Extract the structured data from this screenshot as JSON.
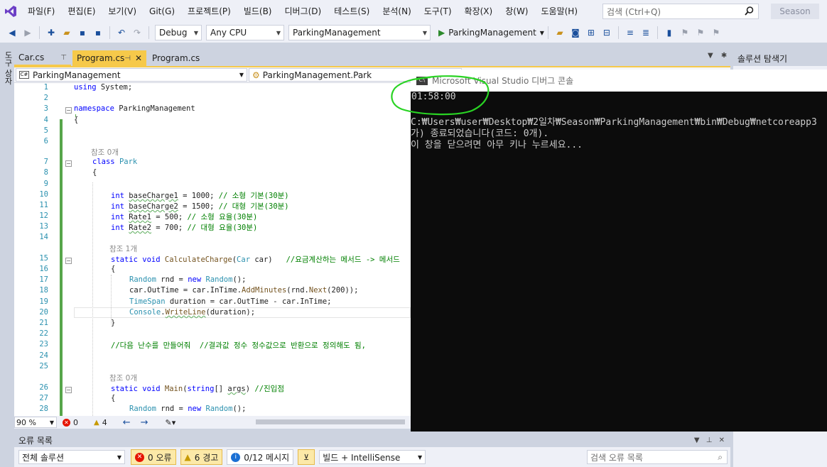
{
  "menu": {
    "items": [
      "파일(F)",
      "편집(E)",
      "보기(V)",
      "Git(G)",
      "프로젝트(P)",
      "빌드(B)",
      "디버그(D)",
      "테스트(S)",
      "분석(N)",
      "도구(T)",
      "확장(X)",
      "창(W)",
      "도움말(H)"
    ],
    "search_placeholder": "검색 (Ctrl+Q)",
    "account": "Season"
  },
  "toolbar": {
    "config": "Debug",
    "platform": "Any CPU",
    "project": "ParkingManagement",
    "run_label": "ParkingManagement"
  },
  "left_strip": {
    "label": "도구 상자"
  },
  "tabs": [
    {
      "label": "Car.cs",
      "state": "preview"
    },
    {
      "label": "Program.cs",
      "state": "active"
    },
    {
      "label": "Program.cs",
      "state": "normal"
    }
  ],
  "navbar": {
    "project": "ParkingManagement",
    "type": "ParkingManagement.Park"
  },
  "code": {
    "refs": {
      "r0_class": "참조 0개",
      "r1": "참조 1개",
      "r0_main": "참조 0개"
    },
    "lines": [
      {
        "n": "1",
        "t": "using System;"
      },
      {
        "n": "3",
        "t": "namespace ParkingManagement"
      },
      {
        "n": "4",
        "t": "{"
      },
      {
        "n": "5",
        "t": ""
      },
      {
        "n": "6",
        "t": ""
      },
      {
        "n": "7",
        "t": "class Park"
      },
      {
        "n": "8",
        "t": "{"
      },
      {
        "n": "9",
        "t": ""
      },
      {
        "n": "10",
        "t": "int baseCharge1 = 1000; // 소형 기본(30분)"
      },
      {
        "n": "11",
        "t": "int baseCharge2 = 1500; // 대형 기본(30분)"
      },
      {
        "n": "12",
        "t": "int Rate1 = 500; // 소형 요율(30분)"
      },
      {
        "n": "13",
        "t": "int Rate2 = 700; // 대형 요율(30분)"
      },
      {
        "n": "14",
        "t": ""
      },
      {
        "n": "15",
        "t": "static void CalculateCharge(Car car)   //요금계산하는 메서드 -> 메서드"
      },
      {
        "n": "16",
        "t": "{"
      },
      {
        "n": "17",
        "t": "Random rnd = new Random();"
      },
      {
        "n": "18",
        "t": "car.OutTime = car.InTime.AddMinutes(rnd.Next(200));"
      },
      {
        "n": "19",
        "t": "TimeSpan duration = car.OutTime - car.InTime;"
      },
      {
        "n": "20",
        "t": "Console.WriteLine(duration);"
      },
      {
        "n": "21",
        "t": "}"
      },
      {
        "n": "22",
        "t": ""
      },
      {
        "n": "23",
        "t": "//다음 난수를 만들어줘  //결과값 정수 정수값으로 반환으로 정의해도 됨,"
      },
      {
        "n": "24",
        "t": ""
      },
      {
        "n": "25",
        "t": ""
      },
      {
        "n": "26",
        "t": "static void Main(string[] args) //진입점"
      },
      {
        "n": "27",
        "t": "{"
      },
      {
        "n": "28",
        "t": "Random rnd = new Random();"
      }
    ],
    "line2": "2"
  },
  "editor_status": {
    "zoom": "90 %",
    "errors": "0",
    "warnings": "4"
  },
  "error_list": {
    "title": "오류 목록",
    "scope": "전체 솔루션",
    "errors_btn": "0 오류",
    "warnings_btn": "6 경고",
    "messages_btn": "0/12 메시지",
    "build_filter": "빌드 + IntelliSense",
    "search_placeholder": "검색 오류 목록"
  },
  "solution_explorer": {
    "title": "솔루션 탐색기"
  },
  "console": {
    "title": "Microsoft Visual Studio 디버그 콘솔",
    "output_time": "01:58:00",
    "exit_line": "C:₩Users₩user₩Desktop₩2일차₩Season₩ParkingManagement₩bin₩Debug₩netcoreapp3",
    "exit_line2": "가) 종료되었습니다(코드: 0개).",
    "close_line": "이 창을 닫으려면 아무 키나 누르세요..."
  }
}
